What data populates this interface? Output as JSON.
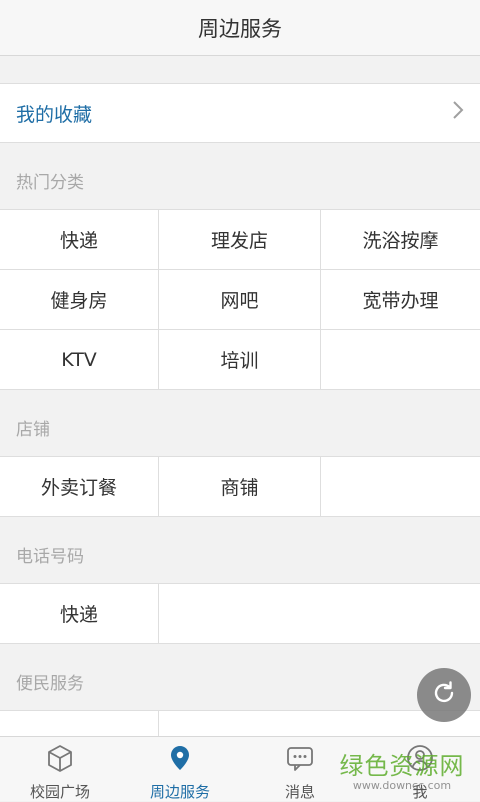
{
  "header": {
    "title": "周边服务"
  },
  "favorites": {
    "label": "我的收藏"
  },
  "sections": {
    "hot": {
      "title": "热门分类",
      "items": [
        "快递",
        "理发店",
        "洗浴按摩",
        "健身房",
        "网吧",
        "宽带办理",
        "KTV",
        "培训"
      ]
    },
    "shops": {
      "title": "店铺",
      "items": [
        "外卖订餐",
        "商铺"
      ]
    },
    "phone": {
      "title": "电话号码",
      "items": [
        "快递"
      ]
    },
    "convenience": {
      "title": "便民服务"
    }
  },
  "tabbar": {
    "items": [
      {
        "label": "校园广场",
        "icon": "cube-icon"
      },
      {
        "label": "周边服务",
        "icon": "location-pin-icon",
        "active": true
      },
      {
        "label": "消息",
        "icon": "message-icon"
      },
      {
        "label": "我",
        "icon": "person-icon"
      }
    ]
  },
  "colors": {
    "accent": "#1f6ea6",
    "watermark": "#5fae2e"
  },
  "watermark": {
    "cn": "绿色资源网",
    "en": "www.downcc.com"
  }
}
